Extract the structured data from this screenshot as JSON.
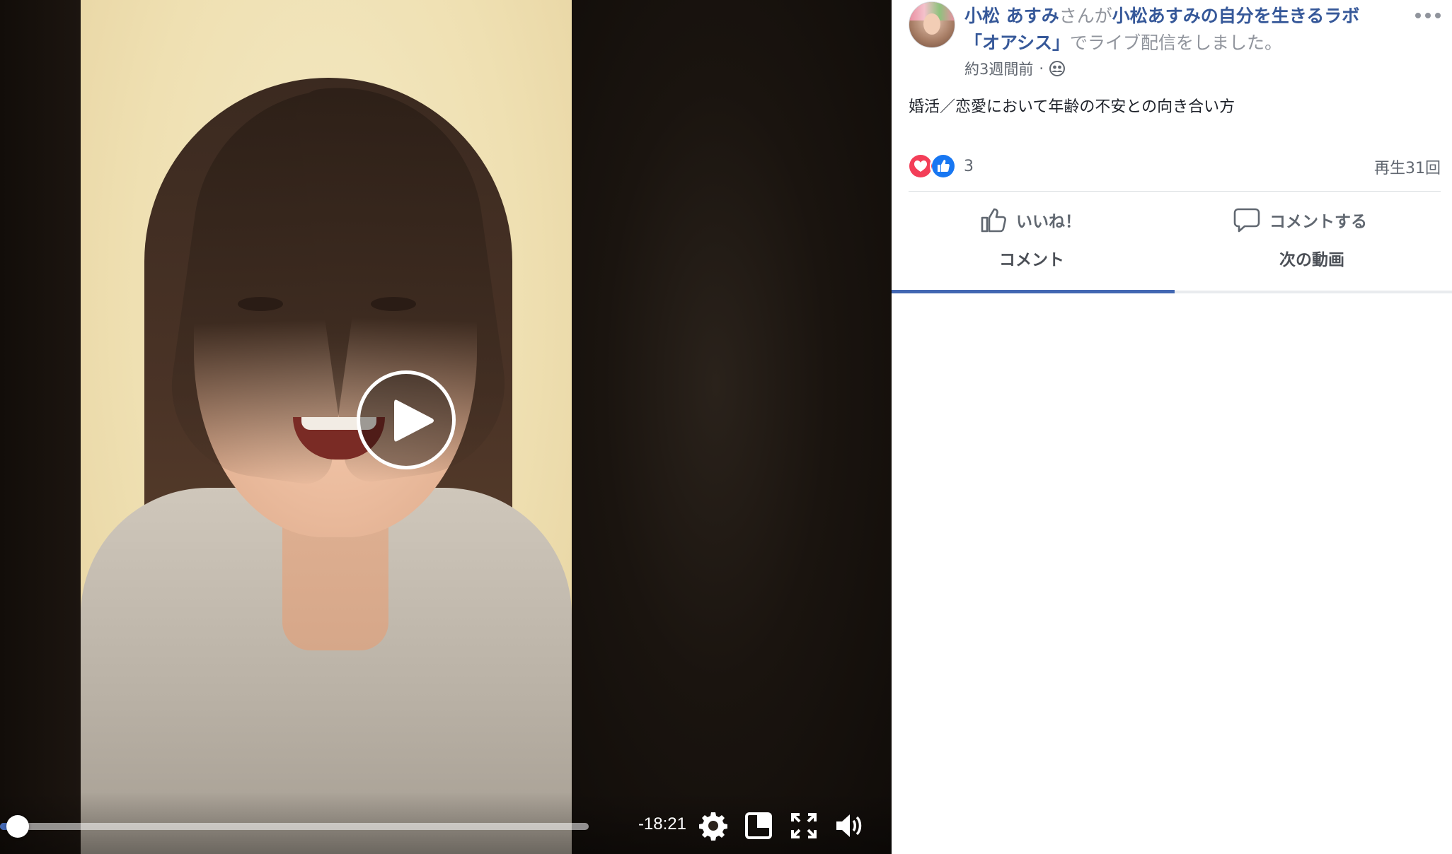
{
  "video": {
    "time_remaining": "-18:21",
    "progress_fraction": 0.03,
    "icons": [
      "play-icon",
      "settings-gear-icon",
      "picture-in-picture-icon",
      "fullscreen-icon",
      "volume-icon"
    ]
  },
  "post": {
    "author_name": "小松 あすみ",
    "header_connector": "さんが",
    "group_name_line1": "小松あすみの自分を生きるラボ",
    "group_name_line2": "「オアシス」",
    "header_suffix": "でライブ配信をしました。",
    "timestamp": "約3週間前",
    "meta_separator": "·",
    "privacy_icon": "group-icon",
    "more_icon": "more-options-icon",
    "text": "婚活／恋愛において年齢の不安との向き合い方",
    "reaction_count": "3",
    "reaction_icons": [
      "love-reaction-icon",
      "like-reaction-icon"
    ],
    "view_count": "再生31回"
  },
  "actions": {
    "like_label": "いいね！",
    "comment_label": "コメントする"
  },
  "tabs": {
    "comments_label": "コメント",
    "next_videos_label": "次の動画",
    "active": "comments"
  },
  "colors": {
    "link_blue": "#365899",
    "accent_blue": "#4267b2",
    "secondary_text": "#616770",
    "love_red": "#f33e58",
    "like_blue": "#1877f2"
  }
}
